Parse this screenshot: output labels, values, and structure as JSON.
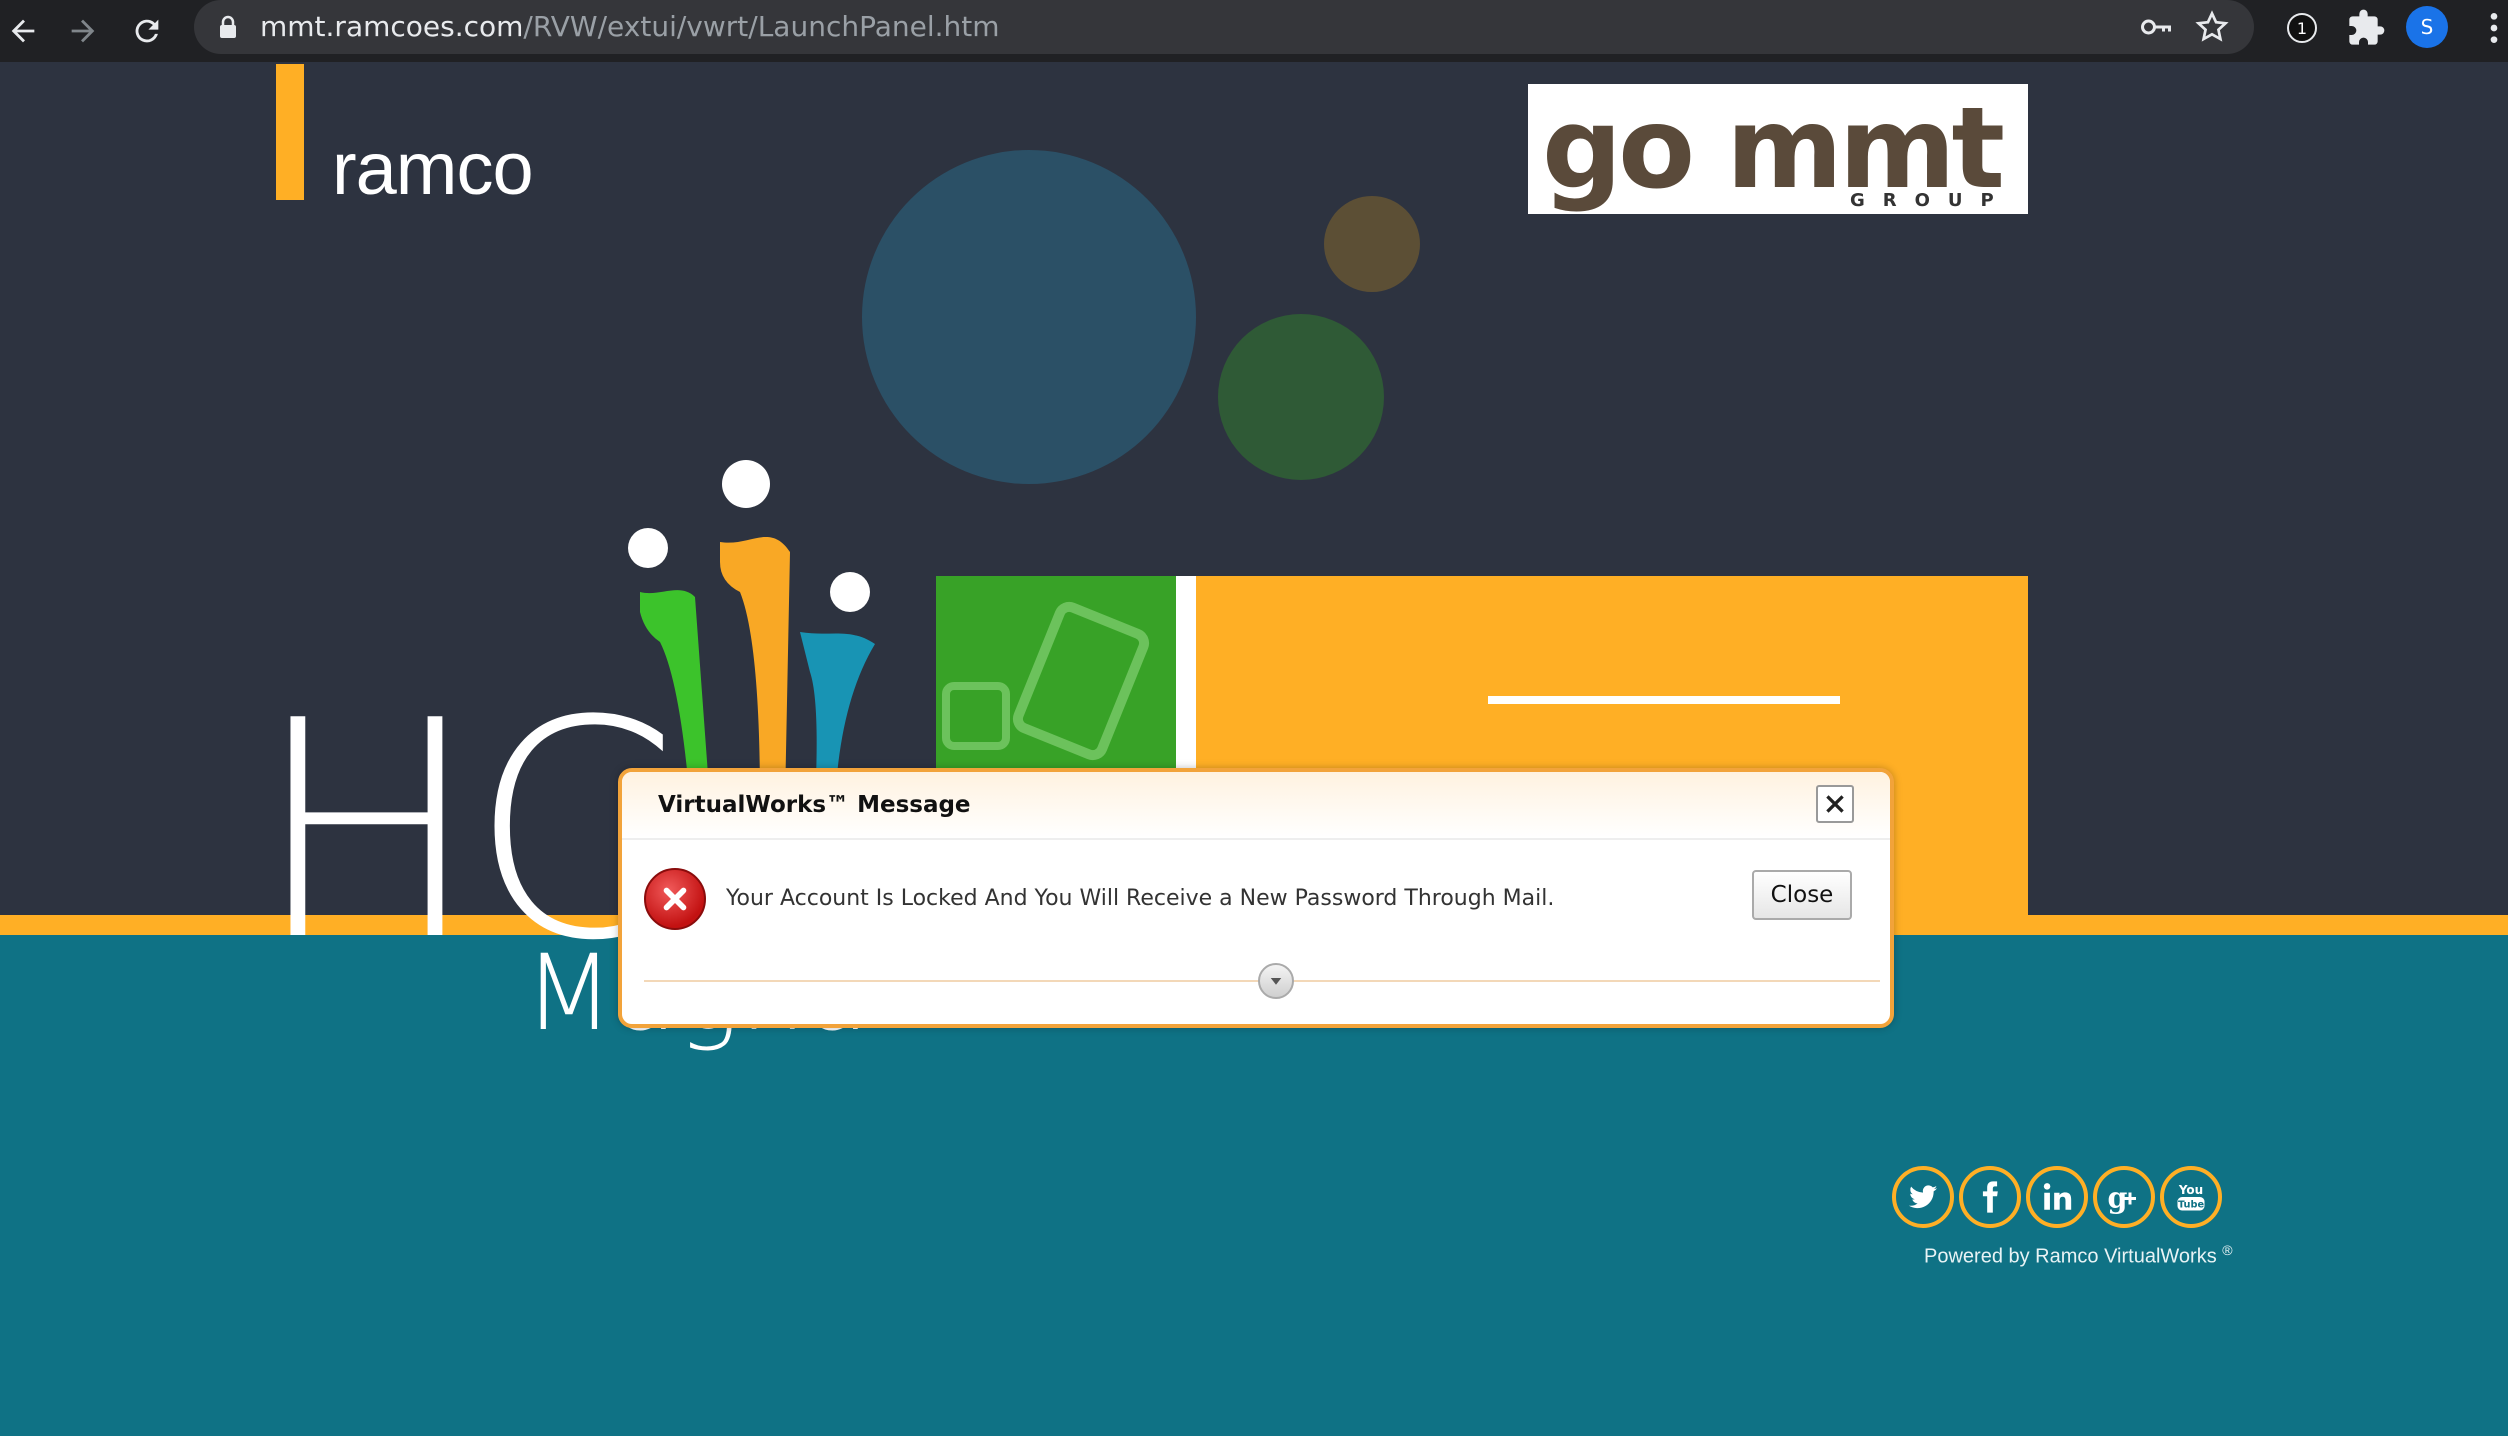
{
  "browser": {
    "url_host": "mmt.ramcoes.com",
    "url_path": "/RVW/extui/vwrt/LaunchPanel.htm",
    "extension_badge": "1",
    "profile_initial": "S"
  },
  "page": {
    "brand_logo": "ramco",
    "client_logo_main": "go mmt",
    "client_logo_sub": "GROUP",
    "product_big": "HC",
    "product_sub": "Magna",
    "powered_by": "Powered by Ramco VirtualWorks",
    "powered_mark": "®",
    "social": [
      {
        "name": "twitter",
        "glyph": "t"
      },
      {
        "name": "facebook",
        "glyph": "f"
      },
      {
        "name": "linkedin",
        "glyph": "in"
      },
      {
        "name": "googleplus",
        "glyph": "g+"
      },
      {
        "name": "youtube",
        "glyph": "You"
      }
    ]
  },
  "dialog": {
    "title": "VirtualWorks™ Message",
    "close_x": "✕",
    "message": "Your Account Is Locked And You Will Receive a New Password Through Mail.",
    "close_label": "Close"
  },
  "colors": {
    "accent_orange": "#ffaf25",
    "teal": "#0f7285",
    "dark": "#2d3340",
    "green": "#38a227"
  }
}
